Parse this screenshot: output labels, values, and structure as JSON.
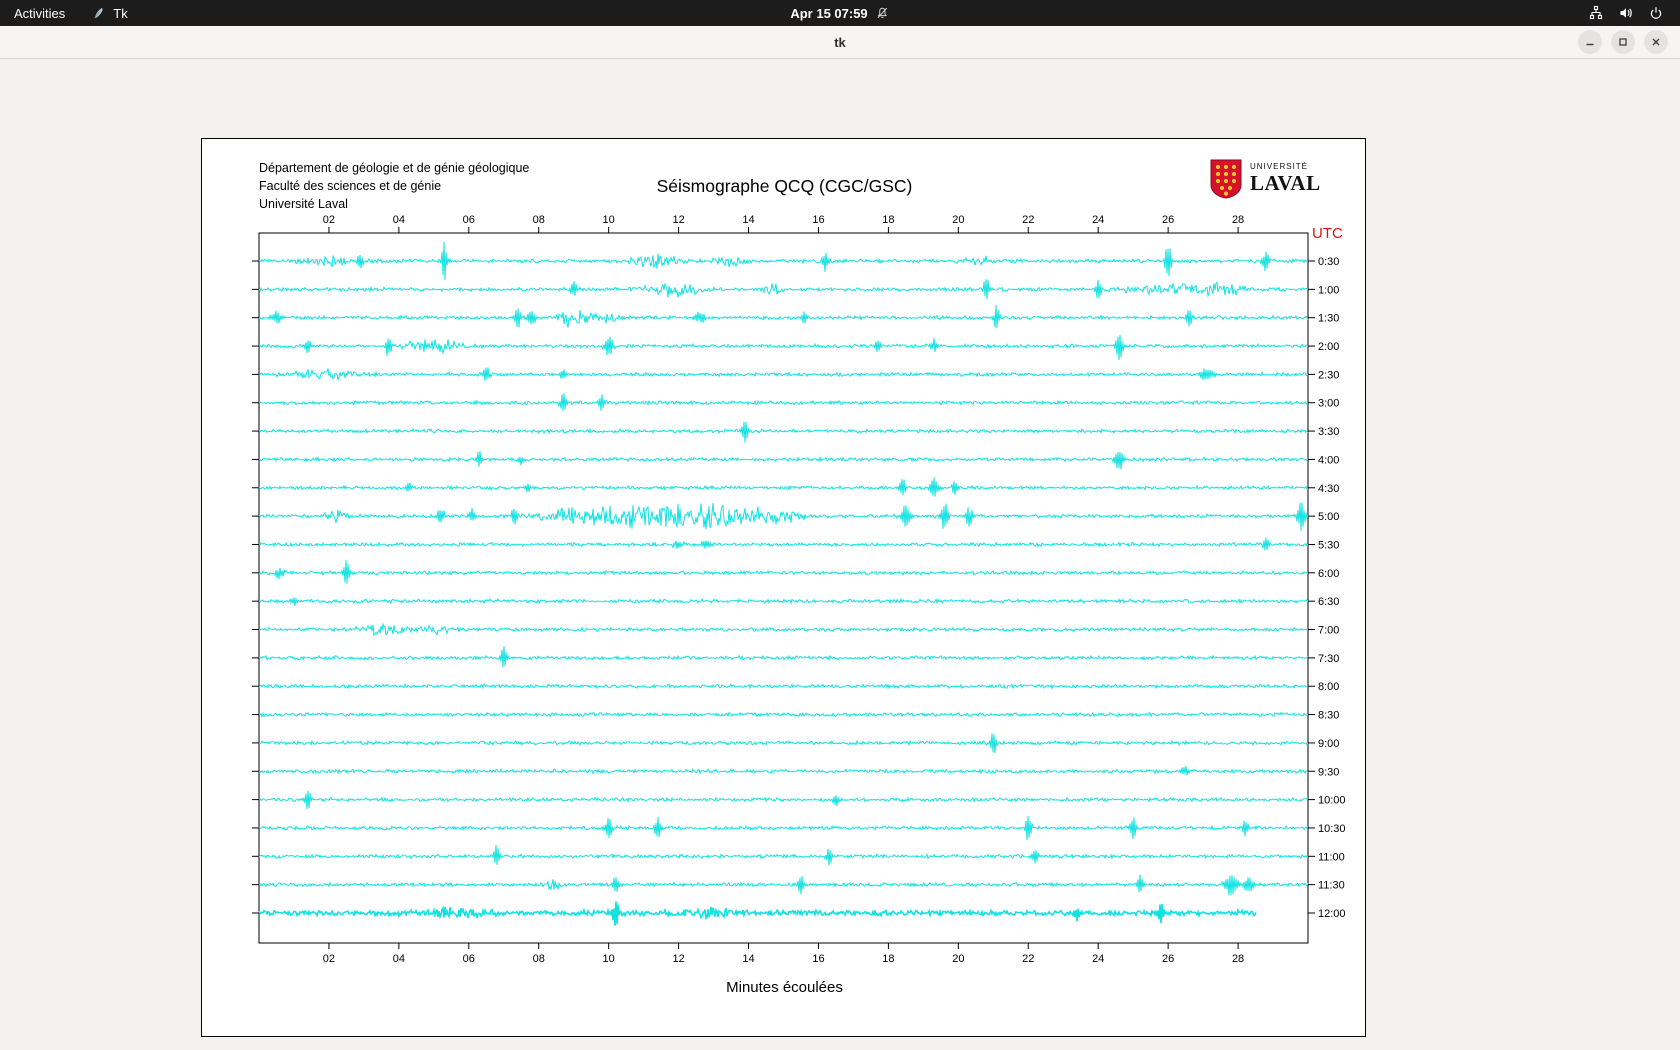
{
  "top_bar": {
    "activities_label": "Activities",
    "app_name": "Tk",
    "clock": "Apr 15 07:59"
  },
  "window": {
    "title": "tk"
  },
  "seismograph": {
    "header_lines": [
      "Département de géologie et de génie géologique",
      "Faculté des sciences et de génie",
      "Université Laval"
    ],
    "title": "Séismographe QCQ (CGC/GSC)",
    "utc_label": "UTC",
    "x_label": "Minutes écoulées",
    "logo": {
      "top": "UNIVERSITÉ",
      "bottom": "LAVAL",
      "red": "#d6112b",
      "gold": "#ffc72c"
    },
    "trace_color": "#12e2e2",
    "x_ticks": [
      "02",
      "04",
      "06",
      "08",
      "10",
      "12",
      "14",
      "16",
      "18",
      "20",
      "22",
      "24",
      "26",
      "28"
    ],
    "x_range_minutes": [
      0,
      30
    ],
    "rows": [
      {
        "label": "0:30",
        "events": [
          [
            2.0,
            3,
            0.5
          ],
          [
            2.9,
            8,
            0.06
          ],
          [
            5.3,
            22,
            0.05
          ],
          [
            11.3,
            5,
            0.4
          ],
          [
            13.5,
            3,
            0.3
          ],
          [
            16.2,
            10,
            0.06
          ],
          [
            20.5,
            3,
            0.3
          ],
          [
            26.0,
            19,
            0.06
          ],
          [
            28.8,
            11,
            0.07
          ]
        ]
      },
      {
        "label": "1:00",
        "events": [
          [
            9.0,
            9,
            0.06
          ],
          [
            11.8,
            4,
            0.5
          ],
          [
            14.7,
            3,
            0.2
          ],
          [
            20.8,
            13,
            0.06
          ],
          [
            24.0,
            11,
            0.06
          ],
          [
            26.0,
            3,
            0.8
          ],
          [
            27.6,
            5,
            0.3
          ]
        ]
      },
      {
        "label": "1:30",
        "events": [
          [
            0.5,
            7,
            0.1
          ],
          [
            7.4,
            12,
            0.06
          ],
          [
            7.8,
            7,
            0.1
          ],
          [
            9.0,
            5,
            0.3
          ],
          [
            9.9,
            6,
            0.2
          ],
          [
            12.6,
            6,
            0.1
          ],
          [
            15.6,
            7,
            0.06
          ],
          [
            21.1,
            13,
            0.06
          ],
          [
            26.6,
            11,
            0.06
          ]
        ]
      },
      {
        "label": "2:00",
        "events": [
          [
            1.4,
            9,
            0.06
          ],
          [
            3.7,
            11,
            0.06
          ],
          [
            5.0,
            4,
            0.5
          ],
          [
            10.0,
            12,
            0.08
          ],
          [
            17.7,
            7,
            0.06
          ],
          [
            19.3,
            8,
            0.06
          ],
          [
            24.6,
            15,
            0.08
          ]
        ]
      },
      {
        "label": "2:30",
        "events": [
          [
            1.8,
            3,
            0.6
          ],
          [
            6.5,
            11,
            0.06
          ],
          [
            8.7,
            7,
            0.06
          ],
          [
            27.1,
            6,
            0.15
          ]
        ]
      },
      {
        "label": "3:00",
        "events": [
          [
            8.7,
            13,
            0.06
          ],
          [
            9.8,
            9,
            0.06
          ]
        ]
      },
      {
        "label": "3:30",
        "events": [
          [
            13.9,
            12,
            0.06
          ]
        ]
      },
      {
        "label": "4:00",
        "events": [
          [
            6.3,
            9,
            0.06
          ],
          [
            7.5,
            5,
            0.06
          ],
          [
            24.6,
            12,
            0.08
          ]
        ]
      },
      {
        "label": "4:30",
        "events": [
          [
            4.3,
            5,
            0.06
          ],
          [
            7.7,
            5,
            0.06
          ],
          [
            18.4,
            10,
            0.06
          ],
          [
            19.3,
            13,
            0.08
          ],
          [
            19.9,
            8,
            0.06
          ]
        ]
      },
      {
        "label": "5:00",
        "events": [
          [
            2.2,
            3,
            0.2
          ],
          [
            5.2,
            9,
            0.08
          ],
          [
            6.1,
            7,
            0.06
          ],
          [
            7.3,
            9,
            0.06
          ],
          [
            9.0,
            4,
            0.5
          ],
          [
            10.8,
            6,
            1.2
          ],
          [
            13.0,
            6,
            1.0
          ],
          [
            14.8,
            4,
            0.5
          ],
          [
            18.5,
            12,
            0.1
          ],
          [
            19.6,
            15,
            0.08
          ],
          [
            20.3,
            10,
            0.08
          ],
          [
            29.8,
            15,
            0.08
          ]
        ]
      },
      {
        "label": "5:30",
        "events": [
          [
            12.0,
            5,
            0.1
          ],
          [
            12.8,
            5,
            0.1
          ],
          [
            28.8,
            9,
            0.06
          ]
        ]
      },
      {
        "label": "6:00",
        "events": [
          [
            0.6,
            6,
            0.1
          ],
          [
            2.5,
            15,
            0.06
          ]
        ]
      },
      {
        "label": "6:30",
        "events": [
          [
            1.0,
            5,
            0.06
          ]
        ]
      },
      {
        "label": "7:00",
        "events": [
          [
            3.5,
            3,
            0.4
          ],
          [
            5.0,
            3,
            0.3
          ]
        ]
      },
      {
        "label": "7:30",
        "events": [
          [
            7.0,
            13,
            0.06
          ]
        ]
      },
      {
        "label": "8:00",
        "events": []
      },
      {
        "label": "8:30",
        "events": []
      },
      {
        "label": "9:00",
        "events": [
          [
            21.0,
            13,
            0.06
          ]
        ]
      },
      {
        "label": "9:30",
        "events": [
          [
            26.5,
            5,
            0.1
          ]
        ]
      },
      {
        "label": "10:00",
        "events": [
          [
            1.4,
            11,
            0.06
          ],
          [
            16.5,
            9,
            0.06
          ]
        ]
      },
      {
        "label": "10:30",
        "events": [
          [
            10.0,
            13,
            0.06
          ],
          [
            11.4,
            10,
            0.06
          ],
          [
            22.0,
            15,
            0.06
          ],
          [
            25.0,
            13,
            0.06
          ],
          [
            28.2,
            9,
            0.06
          ]
        ]
      },
      {
        "label": "11:00",
        "events": [
          [
            6.8,
            13,
            0.06
          ],
          [
            16.3,
            11,
            0.06
          ],
          [
            22.2,
            8,
            0.06
          ]
        ]
      },
      {
        "label": "11:30",
        "events": [
          [
            8.4,
            3,
            0.2
          ],
          [
            10.2,
            9,
            0.06
          ],
          [
            15.5,
            11,
            0.06
          ],
          [
            25.2,
            9,
            0.06
          ],
          [
            27.8,
            12,
            0.12
          ],
          [
            28.3,
            9,
            0.1
          ]
        ]
      },
      {
        "label": "12:00",
        "end": 28.5,
        "bold": true,
        "base": 1.7,
        "events": [
          [
            5.7,
            3,
            0.4
          ],
          [
            10.2,
            14,
            0.06
          ],
          [
            13.0,
            3,
            0.4
          ],
          [
            23.4,
            9,
            0.06
          ],
          [
            25.8,
            11,
            0.06
          ]
        ]
      }
    ]
  }
}
